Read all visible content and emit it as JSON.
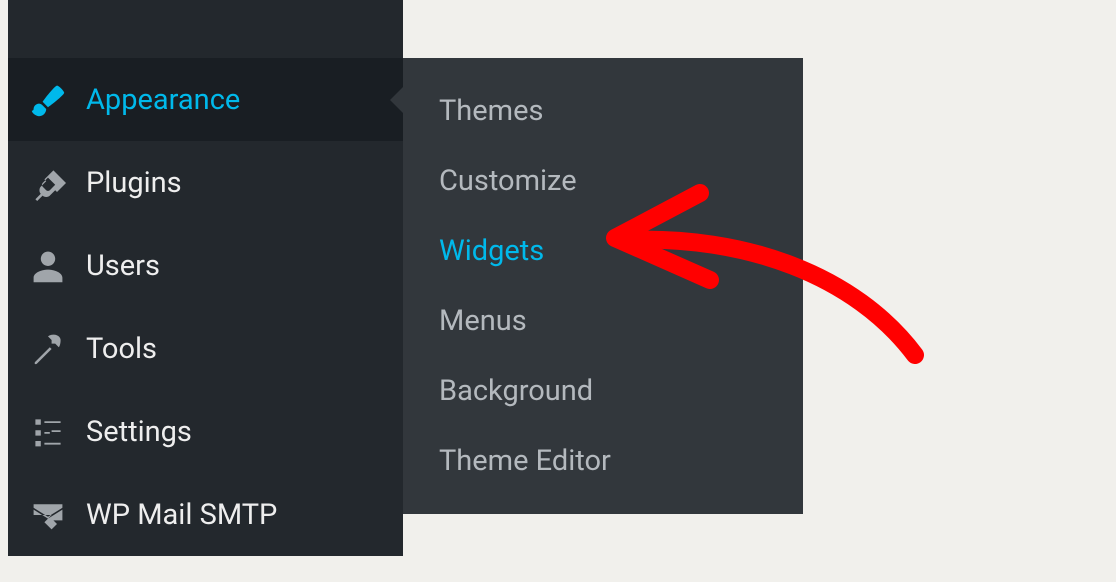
{
  "sidebar": {
    "items": [
      {
        "label": "Appearance",
        "icon": "brush",
        "active": true
      },
      {
        "label": "Plugins",
        "icon": "plug",
        "active": false
      },
      {
        "label": "Users",
        "icon": "user",
        "active": false
      },
      {
        "label": "Tools",
        "icon": "wrench",
        "active": false
      },
      {
        "label": "Settings",
        "icon": "sliders",
        "active": false
      },
      {
        "label": "WP Mail SMTP",
        "icon": "mail-arrow",
        "active": false
      }
    ]
  },
  "submenu": {
    "items": [
      {
        "label": "Themes",
        "active": false
      },
      {
        "label": "Customize",
        "active": false
      },
      {
        "label": "Widgets",
        "active": true
      },
      {
        "label": "Menus",
        "active": false
      },
      {
        "label": "Background",
        "active": false
      },
      {
        "label": "Theme Editor",
        "active": false
      }
    ]
  },
  "colors": {
    "accent": "#00b9eb",
    "sidebar_bg": "#23282d",
    "submenu_bg": "#32373c",
    "annotation": "#ff0000"
  }
}
